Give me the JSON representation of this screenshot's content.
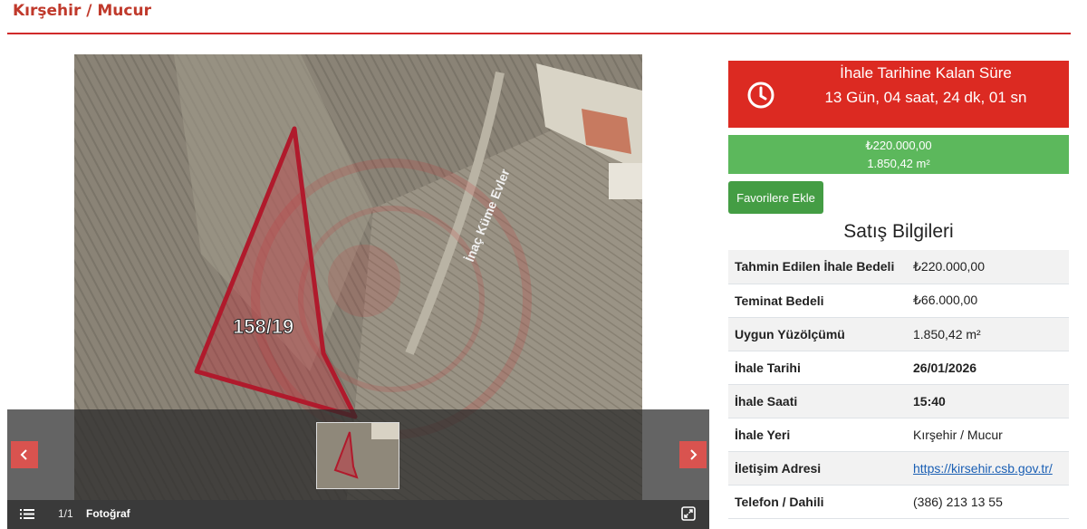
{
  "page": {
    "title": "Kırşehir / Mucur"
  },
  "gallery": {
    "map_road_label": "İnaç Küme Evler",
    "map_parcel_label": "158/19",
    "counter": "1/1",
    "photo_label": "Fotoğraf",
    "prev_icon": "chevron-left-icon",
    "next_icon": "chevron-right-icon",
    "list_icon": "list-icon",
    "expand_icon": "expand-icon"
  },
  "countdown": {
    "title": "İhale Tarihine Kalan Süre",
    "value": "13 Gün, 04 saat, 24 dk, 01 sn",
    "icon": "clock-icon",
    "color": "#dc2a22"
  },
  "summary": {
    "price": "₺220.000,00",
    "area": "1.850,42 m²",
    "color": "#5cb85c"
  },
  "favorite_button": {
    "label": "Favorilere Ekle"
  },
  "sale_info": {
    "title": "Satış Bilgileri",
    "rows": [
      {
        "label": "Tahmin Edilen İhale Bedeli",
        "value": "₺220.000,00"
      },
      {
        "label": "Teminat Bedeli",
        "value": "₺66.000,00"
      },
      {
        "label": "Uygun Yüzölçümü",
        "value": "1.850,42 m²"
      },
      {
        "label": "İhale Tarihi",
        "value": "26/01/2026"
      },
      {
        "label": "İhale Saati",
        "value": "15:40"
      },
      {
        "label": "İhale Yeri",
        "value": "Kırşehir / Mucur"
      },
      {
        "label": "İletişim Adresi",
        "value": "https://kirsehir.csb.gov.tr/"
      },
      {
        "label": "Telefon / Dahili",
        "value": "(386) 213 13 55"
      }
    ]
  }
}
